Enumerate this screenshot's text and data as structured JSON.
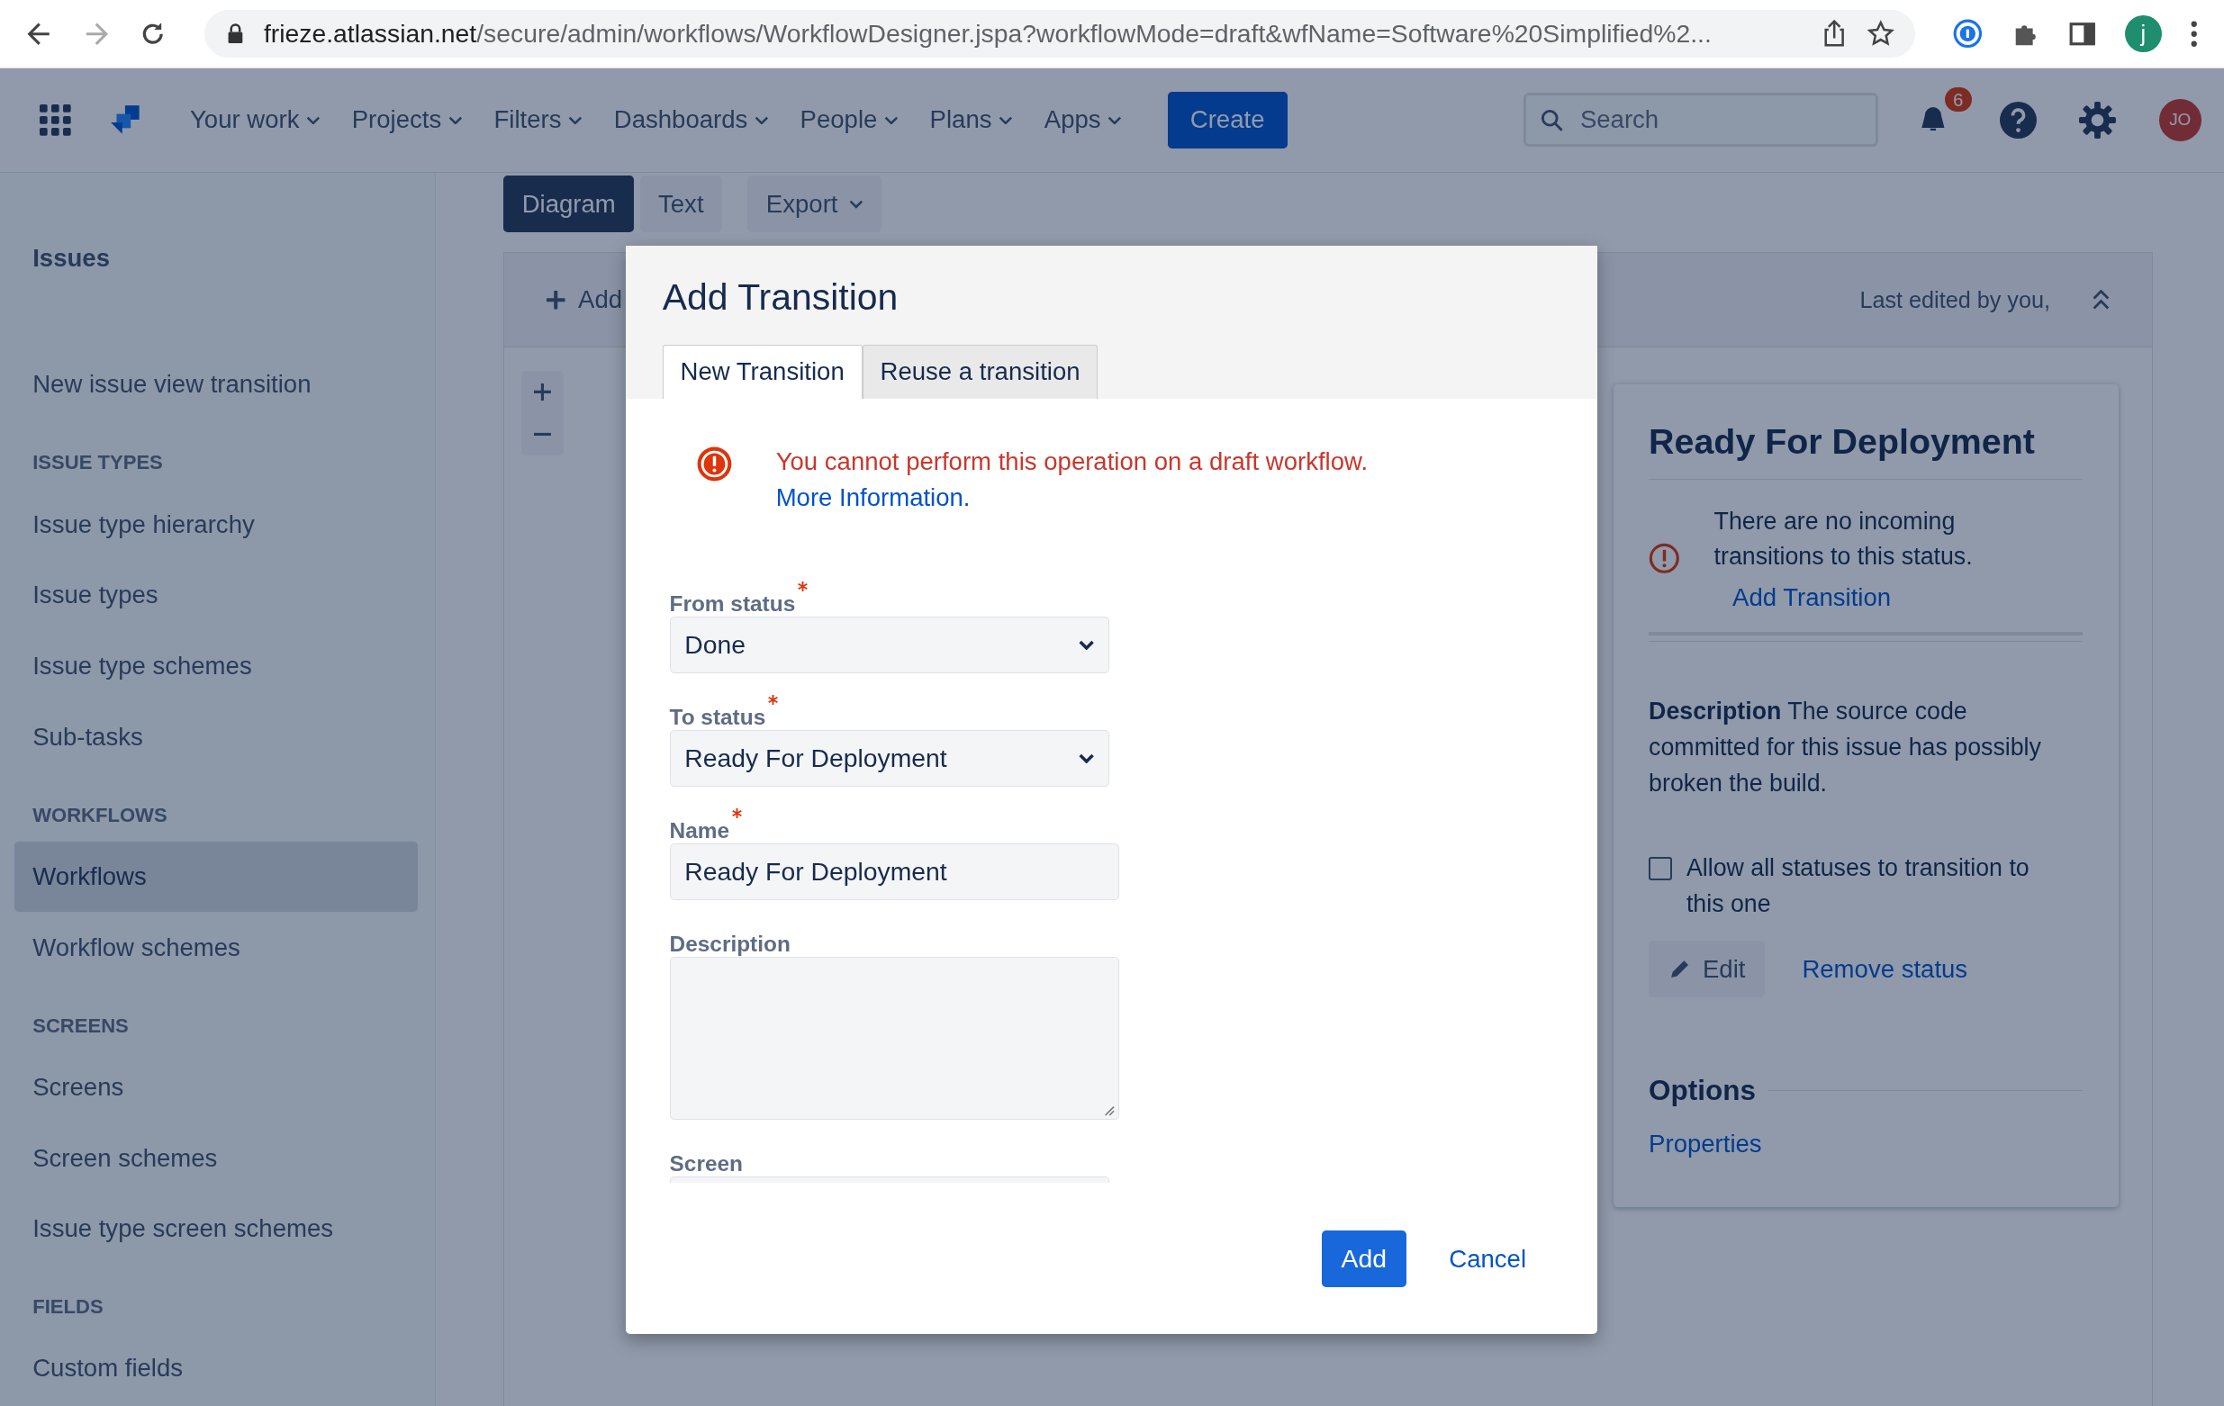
{
  "browser": {
    "url_host": "frieze.atlassian.net",
    "url_path": "/secure/admin/workflows/WorkflowDesigner.jspa?workflowMode=draft&wfName=Software%20Simplified%2...",
    "profile": "j"
  },
  "nav": {
    "items": [
      {
        "label": "Your work"
      },
      {
        "label": "Projects"
      },
      {
        "label": "Filters"
      },
      {
        "label": "Dashboards"
      },
      {
        "label": "People"
      },
      {
        "label": "Plans"
      },
      {
        "label": "Apps"
      }
    ],
    "create": "Create",
    "search": {
      "placeholder": "Search"
    },
    "notifications": "6",
    "avatar": "JO"
  },
  "sidebar": {
    "title": "Issues",
    "sections": [
      {
        "items": [
          {
            "label": "New issue view transition",
            "selected": false
          }
        ]
      },
      {
        "heading": "ISSUE TYPES",
        "items": [
          {
            "label": "Issue type hierarchy",
            "selected": false
          },
          {
            "label": "Issue types",
            "selected": false
          },
          {
            "label": "Issue type schemes",
            "selected": false
          },
          {
            "label": "Sub-tasks",
            "selected": false
          }
        ]
      },
      {
        "heading": "WORKFLOWS",
        "items": [
          {
            "label": "Workflows",
            "selected": true
          },
          {
            "label": "Workflow schemes",
            "selected": false
          }
        ]
      },
      {
        "heading": "SCREENS",
        "items": [
          {
            "label": "Screens",
            "selected": false
          },
          {
            "label": "Screen schemes",
            "selected": false
          },
          {
            "label": "Issue type screen schemes",
            "selected": false
          }
        ]
      },
      {
        "heading": "FIELDS",
        "items": [
          {
            "label": "Custom fields",
            "selected": false
          }
        ]
      }
    ]
  },
  "view_tabs": [
    {
      "label": "Diagram",
      "selected": true
    },
    {
      "label": "Text",
      "selected": false
    }
  ],
  "export_button": "Export",
  "toolbar": {
    "add": "Add",
    "last_edited": "Last edited by you,"
  },
  "status_panel": {
    "title": "Ready For Deployment",
    "warning": "There are no incoming transitions to this status.",
    "add_link": "Add Transition",
    "description": "**Description** The source code committed for this issue has possibly broken the build.",
    "allow_all": {
      "label": "Allow all statuses to transition to this one",
      "checked": false
    },
    "edit": "Edit",
    "remove": "Remove status",
    "options_heading": "Options",
    "properties": "Properties"
  },
  "dialog": {
    "title": "Add Transition",
    "tabs": [
      {
        "label": "New Transition",
        "selected": true
      },
      {
        "label": "Reuse a transition",
        "selected": false
      }
    ],
    "error": {
      "text": "You cannot perform this operation on a draft workflow.",
      "link": "More Information."
    },
    "fields": [
      {
        "kind": "select",
        "label": "From status",
        "required": true,
        "value": "Done"
      },
      {
        "kind": "select",
        "label": "To status",
        "required": true,
        "value": "Ready For Deployment"
      },
      {
        "kind": "text",
        "label": "Name",
        "required": true,
        "value": "Ready For Deployment"
      },
      {
        "kind": "textarea",
        "label": "Description"
      },
      {
        "kind": "cut",
        "label": "Screen"
      }
    ],
    "add": "Add",
    "cancel": "Cancel"
  }
}
